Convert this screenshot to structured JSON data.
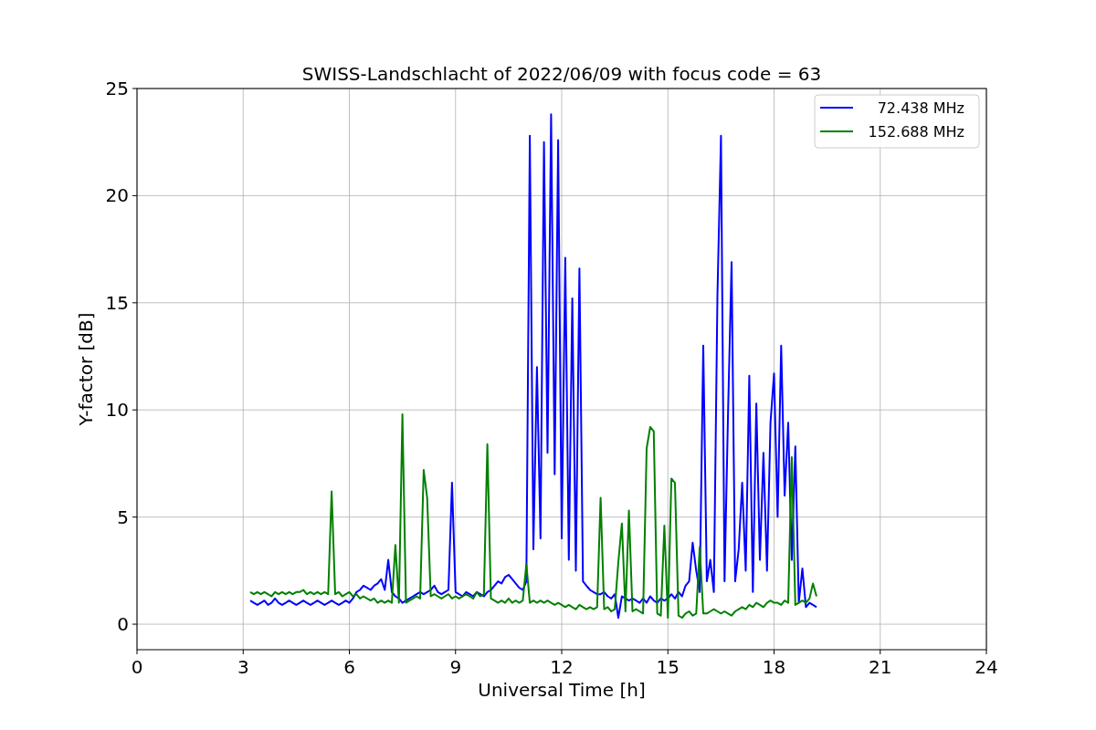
{
  "chart": {
    "chart_data": {
      "type": "line",
      "title": "SWISS-Landschlacht of 2022/06/09 with focus code = 63",
      "xlabel": "Universal Time [h]",
      "ylabel": "Y-factor [dB]",
      "x": [
        3.2,
        3.3,
        3.4,
        3.5,
        3.6,
        3.7,
        3.8,
        3.9,
        4.0,
        4.1,
        4.2,
        4.3,
        4.4,
        4.5,
        4.6,
        4.7,
        4.8,
        4.9,
        5.0,
        5.1,
        5.2,
        5.3,
        5.4,
        5.5,
        5.6,
        5.7,
        5.8,
        5.9,
        6.0,
        6.1,
        6.2,
        6.3,
        6.4,
        6.5,
        6.6,
        6.7,
        6.8,
        6.9,
        7.0,
        7.1,
        7.2,
        7.3,
        7.4,
        7.5,
        7.6,
        7.7,
        7.8,
        7.9,
        8.0,
        8.1,
        8.2,
        8.3,
        8.4,
        8.5,
        8.6,
        8.7,
        8.8,
        8.9,
        9.0,
        9.1,
        9.2,
        9.3,
        9.4,
        9.5,
        9.6,
        9.7,
        9.8,
        9.9,
        10.0,
        10.1,
        10.2,
        10.3,
        10.4,
        10.5,
        10.6,
        10.7,
        10.8,
        10.9,
        11.0,
        11.1,
        11.2,
        11.3,
        11.4,
        11.5,
        11.6,
        11.7,
        11.8,
        11.9,
        12.0,
        12.1,
        12.2,
        12.3,
        12.4,
        12.5,
        12.6,
        12.7,
        12.8,
        12.9,
        13.0,
        13.1,
        13.2,
        13.3,
        13.4,
        13.5,
        13.6,
        13.7,
        13.8,
        13.9,
        14.0,
        14.1,
        14.2,
        14.3,
        14.4,
        14.5,
        14.6,
        14.7,
        14.8,
        14.9,
        15.0,
        15.1,
        15.2,
        15.3,
        15.4,
        15.5,
        15.6,
        15.7,
        15.8,
        15.9,
        16.0,
        16.1,
        16.2,
        16.3,
        16.4,
        16.5,
        16.6,
        16.7,
        16.8,
        16.9,
        17.0,
        17.1,
        17.2,
        17.3,
        17.4,
        17.5,
        17.6,
        17.7,
        17.8,
        17.9,
        18.0,
        18.1,
        18.2,
        18.3,
        18.4,
        18.5,
        18.6,
        18.7,
        18.8,
        18.9,
        19.0,
        19.1,
        19.2
      ],
      "series": [
        {
          "name": "72.438 MHz",
          "color": "#0000ff",
          "values": [
            1.1,
            1.0,
            0.9,
            1.0,
            1.1,
            0.9,
            1.0,
            1.2,
            1.0,
            0.9,
            1.0,
            1.1,
            1.0,
            0.9,
            1.0,
            1.1,
            1.0,
            0.9,
            1.0,
            1.1,
            1.0,
            0.9,
            1.0,
            1.1,
            1.0,
            0.9,
            1.0,
            1.1,
            1.0,
            1.2,
            1.5,
            1.6,
            1.8,
            1.7,
            1.6,
            1.8,
            1.9,
            2.1,
            1.6,
            3.0,
            1.5,
            1.3,
            1.2,
            1.0,
            1.1,
            1.2,
            1.3,
            1.4,
            1.5,
            1.4,
            1.5,
            1.6,
            1.8,
            1.5,
            1.4,
            1.5,
            1.6,
            6.6,
            1.5,
            1.4,
            1.3,
            1.5,
            1.4,
            1.3,
            1.5,
            1.4,
            1.3,
            1.5,
            1.6,
            1.8,
            2.0,
            1.9,
            2.2,
            2.3,
            2.1,
            1.9,
            1.7,
            1.6,
            2.0,
            22.8,
            3.5,
            12.0,
            4.0,
            22.5,
            8.0,
            23.8,
            7.0,
            22.6,
            4.0,
            17.1,
            3.0,
            15.2,
            2.5,
            16.6,
            2.0,
            1.8,
            1.6,
            1.5,
            1.4,
            1.4,
            1.5,
            1.3,
            1.2,
            1.4,
            0.3,
            1.3,
            1.2,
            1.1,
            1.2,
            1.1,
            1.0,
            1.2,
            1.0,
            1.3,
            1.1,
            1.0,
            1.2,
            1.1,
            1.2,
            1.4,
            1.2,
            1.5,
            1.3,
            1.8,
            2.0,
            3.8,
            2.5,
            1.5,
            13.0,
            2.0,
            3.0,
            1.5,
            15.3,
            22.8,
            2.0,
            9.8,
            16.9,
            2.0,
            3.5,
            6.6,
            2.5,
            11.6,
            1.5,
            10.3,
            3.0,
            8.0,
            2.5,
            9.4,
            11.7,
            5.0,
            13.0,
            6.0,
            9.4,
            3.0,
            8.3,
            1.0,
            2.6,
            0.8,
            1.0,
            0.9,
            0.8
          ]
        },
        {
          "name": "152.688 MHz",
          "color": "#008000",
          "values": [
            1.5,
            1.4,
            1.5,
            1.4,
            1.5,
            1.4,
            1.3,
            1.5,
            1.4,
            1.5,
            1.4,
            1.5,
            1.4,
            1.5,
            1.5,
            1.6,
            1.4,
            1.5,
            1.4,
            1.5,
            1.4,
            1.5,
            1.4,
            6.2,
            1.4,
            1.5,
            1.3,
            1.4,
            1.5,
            1.3,
            1.4,
            1.2,
            1.3,
            1.2,
            1.1,
            1.2,
            1.0,
            1.1,
            1.0,
            1.1,
            1.0,
            3.7,
            1.0,
            9.8,
            1.0,
            1.1,
            1.2,
            1.3,
            1.2,
            7.2,
            5.9,
            1.3,
            1.4,
            1.3,
            1.2,
            1.3,
            1.4,
            1.2,
            1.3,
            1.2,
            1.3,
            1.4,
            1.3,
            1.2,
            1.5,
            1.3,
            1.4,
            8.4,
            1.2,
            1.1,
            1.0,
            1.1,
            1.0,
            1.2,
            1.0,
            1.1,
            1.0,
            1.1,
            2.8,
            1.0,
            1.1,
            1.0,
            1.1,
            1.0,
            1.1,
            1.0,
            0.9,
            1.0,
            0.9,
            0.8,
            0.9,
            0.8,
            0.7,
            0.9,
            0.8,
            0.7,
            0.8,
            0.7,
            0.8,
            5.9,
            0.7,
            0.8,
            0.6,
            0.7,
            2.9,
            4.7,
            0.6,
            5.3,
            0.6,
            0.7,
            0.6,
            0.5,
            8.2,
            9.2,
            9.0,
            0.5,
            0.4,
            4.6,
            0.3,
            6.8,
            6.6,
            0.4,
            0.3,
            0.5,
            0.6,
            0.4,
            0.5,
            3.6,
            0.5,
            0.5,
            0.6,
            0.7,
            0.6,
            0.5,
            0.6,
            0.5,
            0.4,
            0.6,
            0.7,
            0.8,
            0.7,
            0.9,
            0.8,
            1.0,
            0.9,
            0.8,
            1.0,
            1.1,
            1.0,
            1.0,
            0.9,
            1.1,
            1.0,
            7.8,
            0.9,
            1.0,
            1.1,
            1.0,
            1.2,
            1.9,
            1.3
          ]
        }
      ],
      "xlim": [
        0,
        24
      ],
      "ylim": [
        -1.19,
        25
      ],
      "xticks": [
        0,
        3,
        6,
        9,
        12,
        15,
        18,
        21,
        24
      ],
      "yticks": [
        0,
        5,
        10,
        15,
        20,
        25
      ],
      "grid": true,
      "legend": "upper right"
    }
  }
}
